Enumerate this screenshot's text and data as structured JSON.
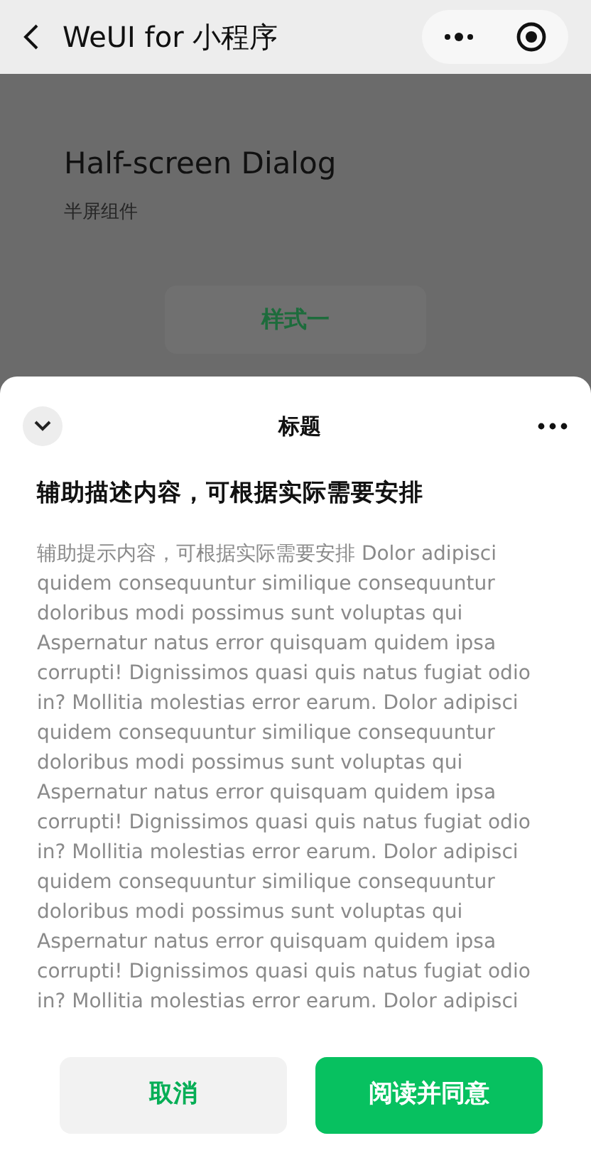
{
  "nav_bar": {
    "title": "WeUI for 小程序"
  },
  "page": {
    "title": "Half-screen Dialog",
    "subtitle": "半屏组件",
    "button": "样式一"
  },
  "dialog": {
    "title": "标题",
    "heading": "辅助描述内容，可根据实际需要安排",
    "body": "辅助提示内容，可根据实际需要安排 Dolor adipisci quidem consequuntur similique consequuntur doloribus modi possimus sunt voluptas qui Aspernatur natus error quisquam quidem ipsa corrupti! Dignissimos quasi quis natus fugiat odio in? Mollitia molestias error earum. Dolor adipisci quidem consequuntur similique consequuntur doloribus modi possimus sunt voluptas qui Aspernatur natus error quisquam quidem ipsa corrupti! Dignissimos quasi quis natus fugiat odio in? Mollitia molestias error earum. Dolor adipisci quidem consequuntur similique consequuntur doloribus modi possimus sunt voluptas qui Aspernatur natus error quisquam quidem ipsa corrupti! Dignissimos quasi quis natus fugiat odio in? Mollitia molestias error earum. Dolor adipisci",
    "buttons": [
      {
        "label": "取消",
        "kind": "secondary"
      },
      {
        "label": "阅读并同意",
        "kind": "primary"
      }
    ]
  }
}
